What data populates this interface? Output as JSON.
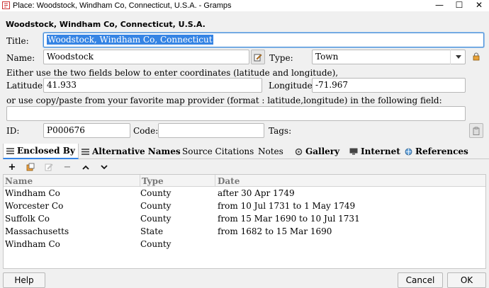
{
  "window": {
    "title": "Place: Woodstock, Windham Co, Connecticut, U.S.A. - Gramps",
    "minimize_glyph": "—",
    "maximize_glyph": "☐",
    "close_glyph": "✕"
  },
  "heading": "Woodstock, Windham Co, Connecticut, U.S.A.",
  "form": {
    "title_label": "Title:",
    "title_value": "Woodstock, Windham Co, Connecticut",
    "name_label": "Name:",
    "name_value": "Woodstock",
    "type_label": "Type:",
    "type_value": "Town",
    "coord_hint": "Either use the two fields below to enter coordinates (latitude and longitude),",
    "latitude_label": "Latitude:",
    "latitude_value": "41.933",
    "longitude_label": "Longitude:",
    "longitude_value": "-71.967",
    "paste_hint": "or use copy/paste from your favorite map provider (format : latitude,longitude) in the following field:",
    "paste_value": "",
    "id_label": "ID:",
    "id_value": "P000676",
    "code_label": "Code:",
    "code_value": "",
    "tags_label": "Tags:"
  },
  "tabs": [
    {
      "label": "Enclosed By",
      "icon": "list-icon"
    },
    {
      "label": "Alternative Names",
      "icon": "list-icon"
    },
    {
      "label": "Source Citations",
      "icon": ""
    },
    {
      "label": "Notes",
      "icon": ""
    },
    {
      "label": "Gallery",
      "icon": "gallery-icon"
    },
    {
      "label": "Internet",
      "icon": "internet-icon"
    },
    {
      "label": "References",
      "icon": "references-icon"
    }
  ],
  "toolbar": {
    "add": "+",
    "remove": "−",
    "up": "⌃",
    "down": "⌄"
  },
  "table": {
    "columns": [
      "Name",
      "Type",
      "Date"
    ],
    "rows": [
      [
        "Windham Co",
        "County",
        "after 30 Apr 1749"
      ],
      [
        "Worcester Co",
        "County",
        "from 10 Jul 1731 to 1 May 1749"
      ],
      [
        "Suffolk Co",
        "County",
        "from 15 Mar 1690 to 10 Jul 1731"
      ],
      [
        "Massachusetts",
        "State",
        "from 1682 to 15 Mar 1690"
      ],
      [
        "Windham Co",
        "County",
        ""
      ]
    ]
  },
  "buttons": {
    "help": "Help",
    "cancel": "Cancel",
    "ok": "OK"
  },
  "colors": {
    "accent": "#3584e4",
    "dialog_bg": "#f0f0f0"
  }
}
